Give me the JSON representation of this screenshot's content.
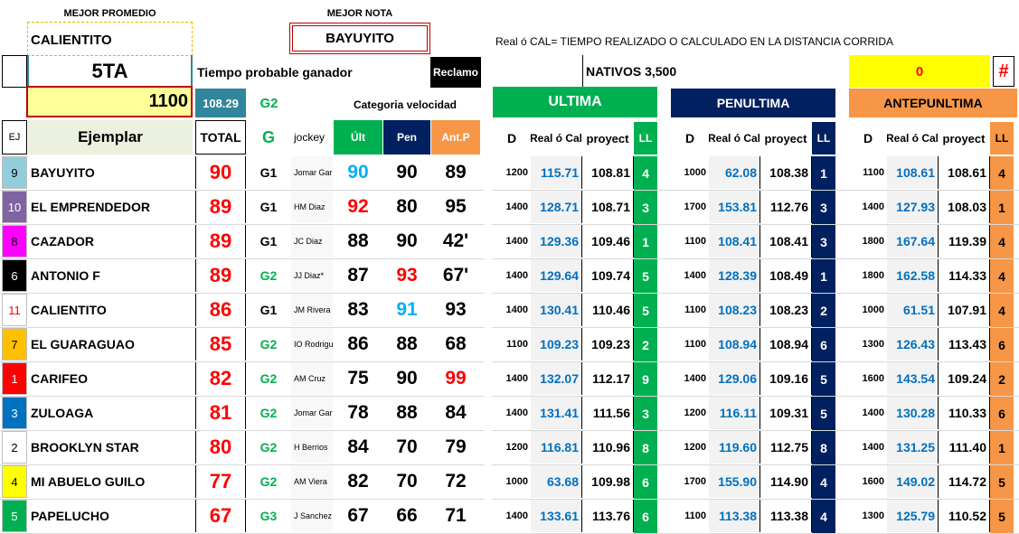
{
  "colors": {
    "green": "#00b050",
    "navy": "#002060",
    "orange": "#f79646",
    "yellow": "#ffff99",
    "yellow_bright": "#ffff00",
    "red": "#ff0000",
    "blue": "#0070c0",
    "cyan": "#00b0f0",
    "teal": "#31869b",
    "gray": "#f2f2f2"
  },
  "header": {
    "mejor_promedio_label": "MEJOR PROMEDIO",
    "mejor_promedio_value": "CALIENTITO",
    "mejor_nota_label": "MEJOR NOTA",
    "mejor_nota_value": "BAYUYITO",
    "note": "Real ó CAL= TIEMPO REALIZADO O CALCULADO EN LA DISTANCIA CORRIDA",
    "race": "5TA",
    "tiempo_label": "Tiempo probable ganador",
    "reclamo_label": "Reclamo",
    "category": "NATIVOS 3,500",
    "zero": "0",
    "hash": "#",
    "distance": "1100",
    "tiempo_value": "108.29",
    "grade": "G2",
    "categoria_velocidad": "Categoria velocidad",
    "ultima": "ULTIMA",
    "penultima": "PENULTIMA",
    "antepenultima": "ANTEPUNLTIMA"
  },
  "columns": {
    "ej": "EJ",
    "ejemplar": "Ejemplar",
    "total": "TOTAL",
    "g": "G",
    "jockey": "jockey",
    "ult": "Últ",
    "pen": "Pen",
    "antp": "Ant.P",
    "d": "D",
    "real": "Real ó Cal",
    "proyect": "proyect",
    "ll": "LL"
  },
  "rows": [
    {
      "num": "9",
      "num_bg": "#92cddc",
      "num_color": "#000000",
      "name": "BAYUYITO",
      "total": "90",
      "grade": "G1",
      "jockey": "Jomar Gar",
      "ult": "90",
      "ult_color": "#00b0f0",
      "pen": "90",
      "pen_color": "#000000",
      "ant": "89",
      "ant_color": "#000000",
      "u": {
        "d": "1200",
        "real": "115.71",
        "proy": "108.81",
        "ll": "4"
      },
      "p": {
        "d": "1000",
        "real": "62.08",
        "proy": "108.38",
        "ll": "1"
      },
      "a": {
        "d": "1100",
        "real": "108.61",
        "proy": "108.61",
        "ll": "4"
      }
    },
    {
      "num": "10",
      "num_bg": "#8064a2",
      "num_color": "#ffffff",
      "name": "EL EMPRENDEDOR",
      "total": "89",
      "grade": "G1",
      "jockey": "HM Diaz",
      "ult": "92",
      "ult_color": "#ff0000",
      "pen": "80",
      "pen_color": "#000000",
      "ant": "95",
      "ant_color": "#000000",
      "u": {
        "d": "1400",
        "real": "128.71",
        "proy": "108.71",
        "ll": "3"
      },
      "p": {
        "d": "1700",
        "real": "153.81",
        "proy": "112.76",
        "ll": "3"
      },
      "a": {
        "d": "1400",
        "real": "127.93",
        "proy": "108.03",
        "ll": "1"
      }
    },
    {
      "num": "8",
      "num_bg": "#ff00ff",
      "num_color": "#000000",
      "name": "CAZADOR",
      "total": "89",
      "grade": "G1",
      "jockey": "JC Diaz",
      "ult": "88",
      "ult_color": "#000000",
      "pen": "90",
      "pen_color": "#000000",
      "ant": "42'",
      "ant_color": "#000000",
      "u": {
        "d": "1400",
        "real": "129.36",
        "proy": "109.46",
        "ll": "1"
      },
      "p": {
        "d": "1100",
        "real": "108.41",
        "proy": "108.41",
        "ll": "3"
      },
      "a": {
        "d": "1800",
        "real": "167.64",
        "proy": "119.39",
        "ll": "4"
      }
    },
    {
      "num": "6",
      "num_bg": "#000000",
      "num_color": "#ffffff",
      "name": "ANTONIO F",
      "total": "89",
      "grade": "G2",
      "jockey": "JJ Diaz*",
      "ult": "87",
      "ult_color": "#000000",
      "pen": "93",
      "pen_color": "#ff0000",
      "ant": "67'",
      "ant_color": "#000000",
      "u": {
        "d": "1400",
        "real": "129.64",
        "proy": "109.74",
        "ll": "5"
      },
      "p": {
        "d": "1400",
        "real": "128.39",
        "proy": "108.49",
        "ll": "1"
      },
      "a": {
        "d": "1800",
        "real": "162.58",
        "proy": "114.33",
        "ll": "4"
      }
    },
    {
      "num": "11",
      "num_bg": "#ffffff",
      "num_color": "#ff0000",
      "name": "CALIENTITO",
      "total": "86",
      "grade": "G1",
      "jockey": "JM Rivera",
      "ult": "83",
      "ult_color": "#000000",
      "pen": "91",
      "pen_color": "#00b0f0",
      "ant": "93",
      "ant_color": "#000000",
      "u": {
        "d": "1400",
        "real": "130.41",
        "proy": "110.46",
        "ll": "5"
      },
      "p": {
        "d": "1100",
        "real": "108.23",
        "proy": "108.23",
        "ll": "2"
      },
      "a": {
        "d": "1000",
        "real": "61.51",
        "proy": "107.91",
        "ll": "4"
      }
    },
    {
      "num": "7",
      "num_bg": "#ffc000",
      "num_color": "#000000",
      "name": "EL GUARAGUAO",
      "total": "85",
      "grade": "G2",
      "jockey": "IO Rodrigu",
      "ult": "86",
      "ult_color": "#000000",
      "pen": "88",
      "pen_color": "#000000",
      "ant": "68",
      "ant_color": "#000000",
      "u": {
        "d": "1100",
        "real": "109.23",
        "proy": "109.23",
        "ll": "2"
      },
      "p": {
        "d": "1100",
        "real": "108.94",
        "proy": "108.94",
        "ll": "6"
      },
      "a": {
        "d": "1300",
        "real": "126.43",
        "proy": "113.43",
        "ll": "6"
      }
    },
    {
      "num": "1",
      "num_bg": "#ff0000",
      "num_color": "#ffffff",
      "name": "CARIFEO",
      "total": "82",
      "grade": "G2",
      "jockey": "AM Cruz",
      "ult": "75",
      "ult_color": "#000000",
      "pen": "90",
      "pen_color": "#000000",
      "ant": "99",
      "ant_color": "#ff0000",
      "u": {
        "d": "1400",
        "real": "132.07",
        "proy": "112.17",
        "ll": "9"
      },
      "p": {
        "d": "1400",
        "real": "129.06",
        "proy": "109.16",
        "ll": "5"
      },
      "a": {
        "d": "1600",
        "real": "143.54",
        "proy": "109.24",
        "ll": "2"
      }
    },
    {
      "num": "3",
      "num_bg": "#0070c0",
      "num_color": "#ffffff",
      "name": "ZULOAGA",
      "total": "81",
      "grade": "G2",
      "jockey": "Jomar Gar",
      "ult": "78",
      "ult_color": "#000000",
      "pen": "88",
      "pen_color": "#000000",
      "ant": "84",
      "ant_color": "#000000",
      "u": {
        "d": "1400",
        "real": "131.41",
        "proy": "111.56",
        "ll": "3"
      },
      "p": {
        "d": "1200",
        "real": "116.11",
        "proy": "109.31",
        "ll": "5"
      },
      "a": {
        "d": "1400",
        "real": "130.28",
        "proy": "110.33",
        "ll": "6"
      }
    },
    {
      "num": "2",
      "num_bg": "#ffffff",
      "num_color": "#000000",
      "name": "BROOKLYN STAR",
      "total": "80",
      "grade": "G2",
      "jockey": "H Berrios",
      "ult": "84",
      "ult_color": "#000000",
      "pen": "70",
      "pen_color": "#000000",
      "ant": "79",
      "ant_color": "#000000",
      "u": {
        "d": "1200",
        "real": "116.81",
        "proy": "110.96",
        "ll": "8"
      },
      "p": {
        "d": "1200",
        "real": "119.60",
        "proy": "112.75",
        "ll": "8"
      },
      "a": {
        "d": "1400",
        "real": "131.25",
        "proy": "111.40",
        "ll": "1"
      }
    },
    {
      "num": "4",
      "num_bg": "#ffff00",
      "num_color": "#000000",
      "name": "MI ABUELO GUILO",
      "total": "77",
      "grade": "G2",
      "jockey": "AM Viera",
      "ult": "82",
      "ult_color": "#000000",
      "pen": "70",
      "pen_color": "#000000",
      "ant": "72",
      "ant_color": "#000000",
      "u": {
        "d": "1000",
        "real": "63.68",
        "proy": "109.98",
        "ll": "6"
      },
      "p": {
        "d": "1700",
        "real": "155.90",
        "proy": "114.90",
        "ll": "4"
      },
      "a": {
        "d": "1600",
        "real": "149.02",
        "proy": "114.72",
        "ll": "5"
      }
    },
    {
      "num": "5",
      "num_bg": "#00b050",
      "num_color": "#ffffff",
      "name": "PAPELUCHO",
      "total": "67",
      "grade": "G3",
      "jockey": "J Sanchez",
      "ult": "67",
      "ult_color": "#000000",
      "pen": "66",
      "pen_color": "#000000",
      "ant": "71",
      "ant_color": "#000000",
      "u": {
        "d": "1400",
        "real": "133.61",
        "proy": "113.76",
        "ll": "6"
      },
      "p": {
        "d": "1100",
        "real": "113.38",
        "proy": "113.38",
        "ll": "4"
      },
      "a": {
        "d": "1300",
        "real": "125.79",
        "proy": "110.52",
        "ll": "5"
      }
    }
  ]
}
